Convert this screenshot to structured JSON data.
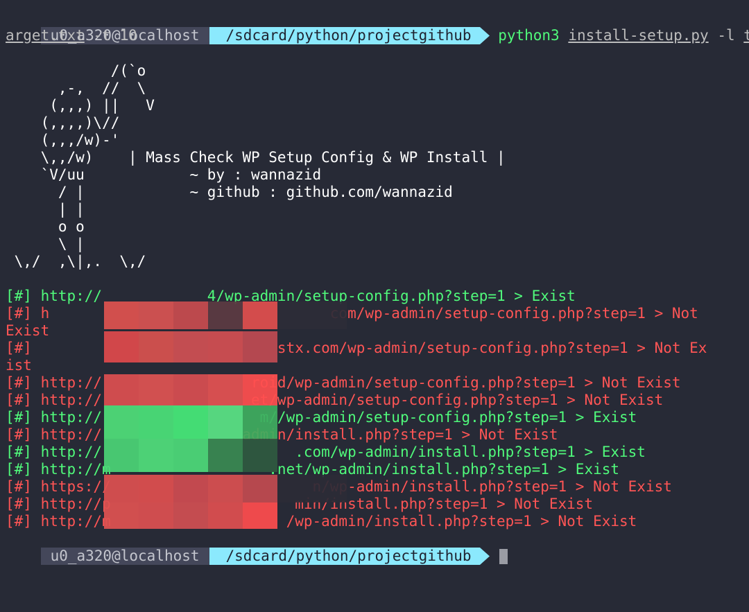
{
  "prompt": {
    "host": "u0_a320@localhost",
    "path": "/sdcard/python/projectgithub",
    "command": "python3",
    "script": "install-setup.py",
    "opt_l": "-l",
    "target_part1": "t",
    "target_part2": "arget.txt",
    "opt_t": "-t 10"
  },
  "banner": {
    "lines": [
      "            /(`o",
      "      ,-,  //  \\",
      "     (,,,) ||   V",
      "    (,,,,)\\//",
      "    (,,,/w)-'",
      "    \\,,/w)    | Mass Check WP Setup Config & WP Install |",
      "    `V/uu            ~ by : wannazid",
      "      / |            ~ github : github.com/wannazid",
      "      | |",
      "      o o",
      "      \\ |",
      " \\,/  ,\\|,.  \\,/"
    ]
  },
  "results": [
    {
      "text": "[#] http://            4/wp-admin/setup-config.php?step=1 > Exist",
      "status": "ok"
    },
    {
      "text": "[#] h                                com/wp-admin/setup-config.php?step=1 > Not",
      "status": "bad"
    },
    {
      "text": "Exist",
      "status": "bad"
    },
    {
      "text": "[#]                            stx.com/wp-admin/setup-config.php?step=1 > Not Ex",
      "status": "bad"
    },
    {
      "text": "ist",
      "status": "bad"
    },
    {
      "text": "[#] http://                 roid/wp-admin/setup-config.php?step=1 > Not Exist",
      "status": "bad"
    },
    {
      "text": "[#] http://                 et/wp-admin/setup-config.php?step=1 > Not Exist",
      "status": "bad"
    },
    {
      "text": "[#] http://                  m//wp-admin/setup-config.php?step=1 > Exist",
      "status": "ok"
    },
    {
      "text": "[#] http://                admin/install.php?step=1 > Not Exist",
      "status": "bad"
    },
    {
      "text": "[#] http://                      .com/wp-admin/install.php?step=1 > Exist",
      "status": "ok"
    },
    {
      "text": "[#] http://m                  .net/wp-admin/install.php?step=1 > Exist",
      "status": "ok"
    },
    {
      "text": "[#] https://                       n/wp-admin/install.php?step=1 > Not Exist",
      "status": "bad"
    },
    {
      "text": "[#] http://p                     min/install.php?step=1 > Not Exist",
      "status": "bad"
    },
    {
      "text": "[#] http://m                    /wp-admin/install.php?step=1 > Not Exist",
      "status": "bad"
    }
  ],
  "colors": {
    "background": "#272a36",
    "ok": "#50fa7b",
    "bad": "#ff5555",
    "path_segment": "#8be9fd",
    "host_segment": "#44475a"
  }
}
